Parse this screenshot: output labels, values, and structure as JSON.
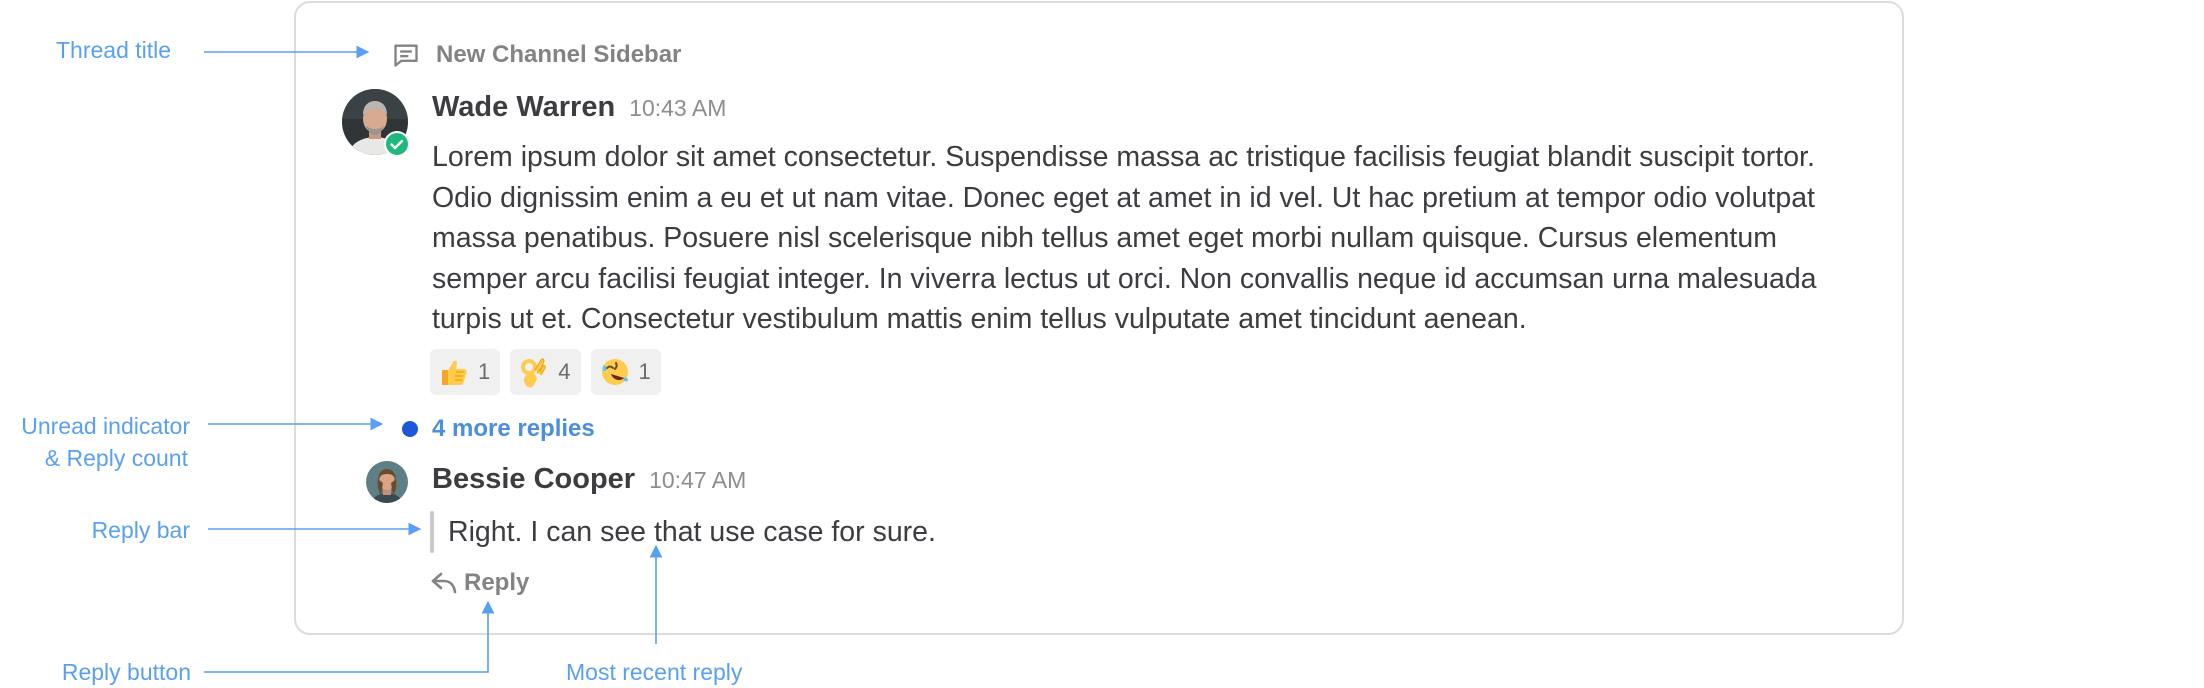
{
  "thread": {
    "title": "New Channel Sidebar",
    "icon": "message-icon"
  },
  "root_post": {
    "author": "Wade Warren",
    "time": "10:43 AM",
    "status": "online-check",
    "body": "Lorem ipsum dolor sit amet consectetur. Suspendisse massa ac tristique facilisis feugiat blandit suscipit tortor. Odio dignissim enim a eu et ut nam vitae. Donec eget at amet in id vel. Ut hac pretium at tempor odio volutpat massa penatibus. Posuere nisl scelerisque nibh tellus amet eget morbi nullam quisque. Cursus elementum semper arcu facilisi feugiat integer. In viverra lectus ut orci. Non convallis neque id accumsan urna malesuada turpis ut et. Consectetur vestibulum mattis enim tellus vulputate amet tincidunt aenean.",
    "reactions": [
      {
        "emoji": "thumbs-up",
        "count": "1"
      },
      {
        "emoji": "ok-hand",
        "count": "4"
      },
      {
        "emoji": "rolling-on-floor-laughing",
        "count": "1"
      }
    ]
  },
  "more_replies": {
    "label": "4 more replies",
    "unread": true
  },
  "latest_reply": {
    "author": "Bessie Cooper",
    "time": "10:47 AM",
    "text": "Right. I can see that use case for sure."
  },
  "reply_button": {
    "label": "Reply"
  },
  "annotations": {
    "thread_title": "Thread title",
    "unread_line1": "Unread indicator",
    "unread_line2": "& Reply count",
    "reply_bar": "Reply bar",
    "reply_button": "Reply button",
    "most_recent_reply": "Most recent reply"
  },
  "colors": {
    "annotation": "#5aa0f2",
    "unread_dot": "#1c58d9",
    "link": "#4b8ee0",
    "online_badge": "#1fb980",
    "card_border": "#dcdcdf"
  }
}
